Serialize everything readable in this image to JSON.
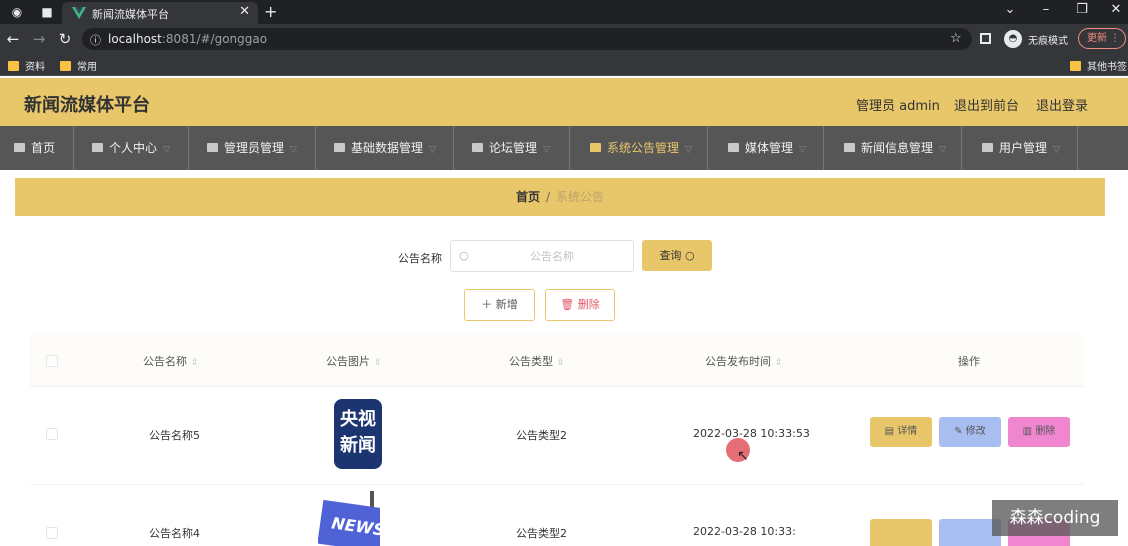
{
  "browser": {
    "tab_title": "新闻流媒体平台",
    "url_host": "localhost",
    "url_rest": ":8081/#/gonggao",
    "incognito_label": "无痕模式",
    "update_label": "更新",
    "bookmarks": [
      "资料",
      "常用"
    ],
    "bookmarks_right": "其他书签"
  },
  "app": {
    "brand": "新闻流媒体平台",
    "admin_label": "管理员 admin",
    "back_front_label": "退出到前台",
    "logout_label": "退出登录",
    "accent_color": "#e8c66a"
  },
  "nav": {
    "items": [
      {
        "label": "首页",
        "icon": "home-icon"
      },
      {
        "label": "个人中心",
        "icon": "user-icon"
      },
      {
        "label": "管理员管理",
        "icon": "bank-icon"
      },
      {
        "label": "基础数据管理",
        "icon": "chat-icon"
      },
      {
        "label": "论坛管理",
        "icon": "flag-icon"
      },
      {
        "label": "系统公告管理",
        "icon": "menu-icon"
      },
      {
        "label": "媒体管理",
        "icon": "document-icon"
      },
      {
        "label": "新闻信息管理",
        "icon": "clock-icon"
      },
      {
        "label": "用户管理",
        "icon": "user-card-icon"
      }
    ],
    "active_index": 5
  },
  "breadcrumb": {
    "home": "首页",
    "separator": "/",
    "current": "系统公告"
  },
  "search": {
    "label": "公告名称",
    "placeholder": "公告名称",
    "value": "",
    "query_label": "查询"
  },
  "actions": {
    "add_label": "新增",
    "delete_label": "删除"
  },
  "table": {
    "headers": [
      "公告名称",
      "公告图片",
      "公告类型",
      "公告发布时间",
      "操作"
    ],
    "rows": [
      {
        "name": "公告名称5",
        "image": "央视新闻",
        "image_lines": [
          "央视",
          "新闻"
        ],
        "type": "公告类型2",
        "time": "2022-03-28 10:33:53"
      },
      {
        "name": "公告名称4",
        "image": "NEWS",
        "type": "公告类型2",
        "time": "2022-03-28 10:33:"
      }
    ],
    "op_labels": {
      "detail": "详情",
      "edit": "修改",
      "delete": "删除"
    }
  },
  "watermark": "森森coding"
}
